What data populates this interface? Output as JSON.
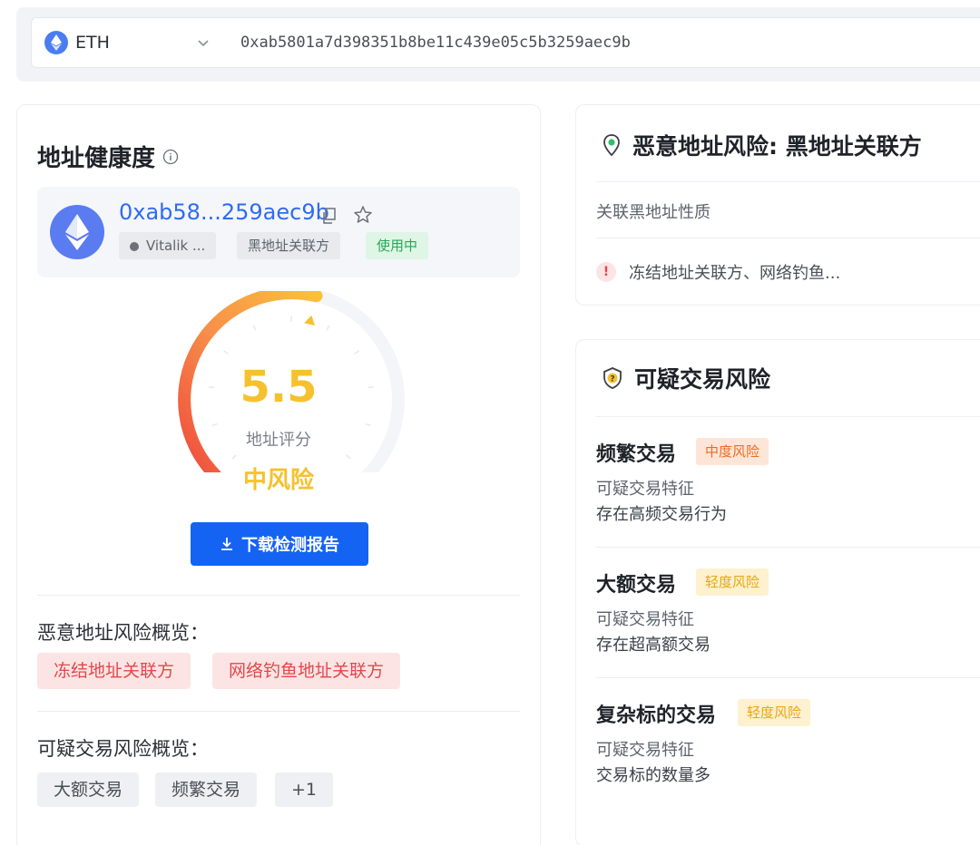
{
  "search": {
    "chain": "ETH",
    "address": "0xab5801a7d398351b8be11c439e05c5b3259aec9b"
  },
  "health": {
    "title": "地址健康度",
    "address_short": "0xab58...259aec9b",
    "tags": [
      "Vitalik ...",
      "黑地址关联方",
      "使用中"
    ],
    "score": "5.5",
    "score_label": "地址评分",
    "risk_level": "中风险",
    "score_fraction": 0.55,
    "download_label": "下载检测报告",
    "malicious_overview_label": "恶意地址风险概览：",
    "malicious_chips": [
      "冻结地址关联方",
      "网络钓鱼地址关联方"
    ],
    "suspicious_overview_label": "可疑交易风险概览：",
    "suspicious_chips": [
      "大额交易",
      "频繁交易",
      "+1"
    ]
  },
  "malicious_card": {
    "title": "恶意地址风险: 黑地址关联方",
    "sub_label": "关联黑地址性质",
    "alert_text": "冻结地址关联方、网络钓鱼..."
  },
  "suspicious_card": {
    "title": "可疑交易风险",
    "items": [
      {
        "title": "频繁交易",
        "tag": "中度风险",
        "feature_label": "可疑交易特征",
        "description": "存在高频交易行为"
      },
      {
        "title": "大额交易",
        "tag": "轻度风险",
        "feature_label": "可疑交易特征",
        "description": "存在超高额交易"
      },
      {
        "title": "复杂标的交易",
        "tag": "轻度风险",
        "feature_label": "可疑交易特征",
        "description": "交易标的数量多"
      }
    ]
  },
  "colors": {
    "primary": "#1463f3",
    "score": "#f6c12e",
    "danger": "#e0484a",
    "success": "#25a857"
  }
}
